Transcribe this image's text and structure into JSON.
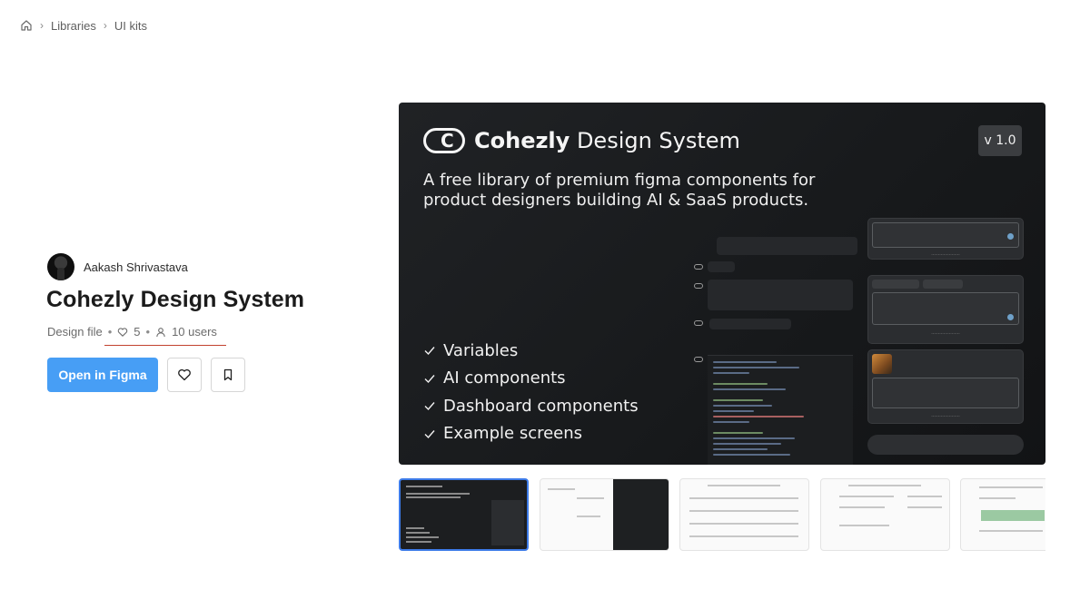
{
  "breadcrumb": {
    "home_icon": "home-icon",
    "items": [
      "Libraries",
      "UI kits"
    ]
  },
  "author": {
    "name": "Aakash Shrivastava"
  },
  "file": {
    "title": "Cohezly Design System",
    "type": "Design file",
    "likes": "5",
    "users": "10 users"
  },
  "actions": {
    "open_label": "Open in Figma",
    "like_icon": "heart-icon",
    "bookmark_icon": "bookmark-icon"
  },
  "hero": {
    "brand_bold": "Cohezly",
    "brand_rest": " Design System",
    "version": "v 1.0",
    "description": "A free library of premium figma components for product designers building AI & SaaS products.",
    "features": [
      "Variables",
      "AI components",
      "Dashboard components",
      "Example screens"
    ]
  },
  "colors": {
    "primary": "#479ef5",
    "hero_bg": "#1a1c1e",
    "active_thumb_border": "#3d7be8",
    "underline": "#c2412f"
  },
  "thumbnails": {
    "count": 5,
    "active_index": 0
  }
}
